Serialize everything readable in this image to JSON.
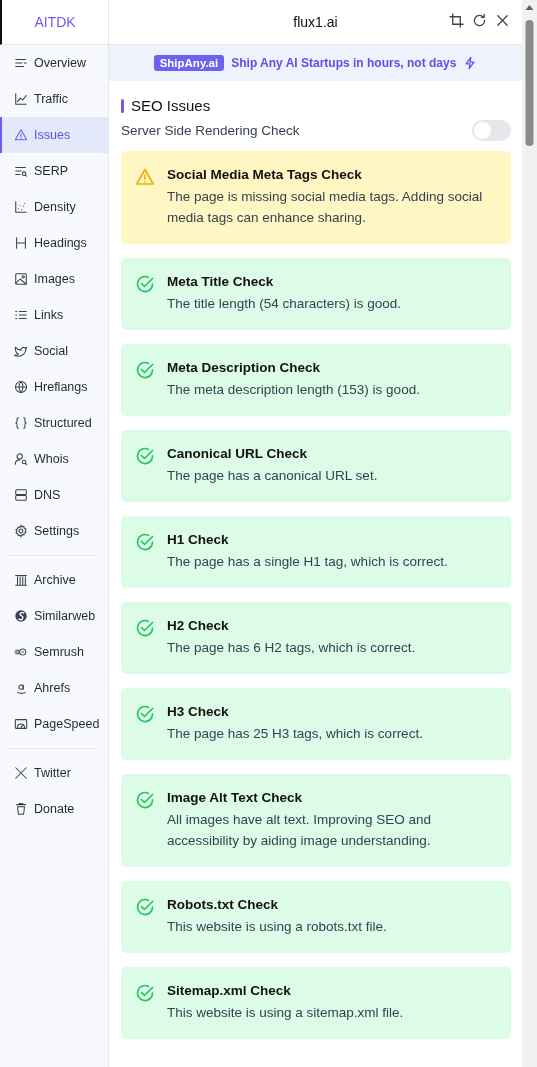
{
  "sidebar": {
    "logo": "AITDK",
    "groups": [
      [
        {
          "label": "Overview",
          "selected": false
        },
        {
          "label": "Traffic",
          "selected": false
        },
        {
          "label": "Issues",
          "selected": true
        },
        {
          "label": "SERP",
          "selected": false
        },
        {
          "label": "Density",
          "selected": false
        },
        {
          "label": "Headings",
          "selected": false
        },
        {
          "label": "Images",
          "selected": false
        },
        {
          "label": "Links",
          "selected": false
        },
        {
          "label": "Social",
          "selected": false
        },
        {
          "label": "Hreflangs",
          "selected": false
        },
        {
          "label": "Structured",
          "selected": false
        },
        {
          "label": "Whois",
          "selected": false
        },
        {
          "label": "DNS",
          "selected": false
        },
        {
          "label": "Settings",
          "selected": false
        }
      ],
      [
        {
          "label": "Archive",
          "selected": false
        },
        {
          "label": "Similarweb",
          "selected": false
        },
        {
          "label": "Semrush",
          "selected": false
        },
        {
          "label": "Ahrefs",
          "selected": false
        },
        {
          "label": "PageSpeed",
          "selected": false
        }
      ],
      [
        {
          "label": "Twitter",
          "selected": false
        },
        {
          "label": "Donate",
          "selected": false
        }
      ]
    ]
  },
  "header": {
    "title": "flux1.ai"
  },
  "banner": {
    "badge": "ShipAny.ai",
    "text": "Ship Any AI Startups in hours, not days"
  },
  "section": {
    "title": "SEO Issues",
    "toggle": {
      "label": "Server Side Rendering Check",
      "on": false
    }
  },
  "checks": [
    {
      "kind": "warning",
      "title": "Social Media Meta Tags Check",
      "text": "The page is missing social media tags. Adding social media tags can enhance sharing."
    },
    {
      "kind": "pass",
      "title": "Meta Title Check",
      "text": "The title length (54 characters) is good."
    },
    {
      "kind": "pass",
      "title": "Meta Description Check",
      "text": "The meta description length (153) is good."
    },
    {
      "kind": "pass",
      "title": "Canonical URL Check",
      "text": "The page has a canonical URL set."
    },
    {
      "kind": "pass",
      "title": "H1 Check",
      "text": "The page has a single H1 tag, which is correct."
    },
    {
      "kind": "pass",
      "title": "H2 Check",
      "text": "The page has 6 H2 tags, which is correct."
    },
    {
      "kind": "pass",
      "title": "H3 Check",
      "text": "The page has 25 H3 tags, which is correct."
    },
    {
      "kind": "pass",
      "title": "Image Alt Text Check",
      "text": "All images have alt text. Improving SEO and accessibility by aiding image understanding."
    },
    {
      "kind": "pass",
      "title": "Robots.txt Check",
      "text": "This website is using a robots.txt file."
    },
    {
      "kind": "pass",
      "title": "Sitemap.xml Check",
      "text": "This website is using a sitemap.xml file."
    }
  ]
}
